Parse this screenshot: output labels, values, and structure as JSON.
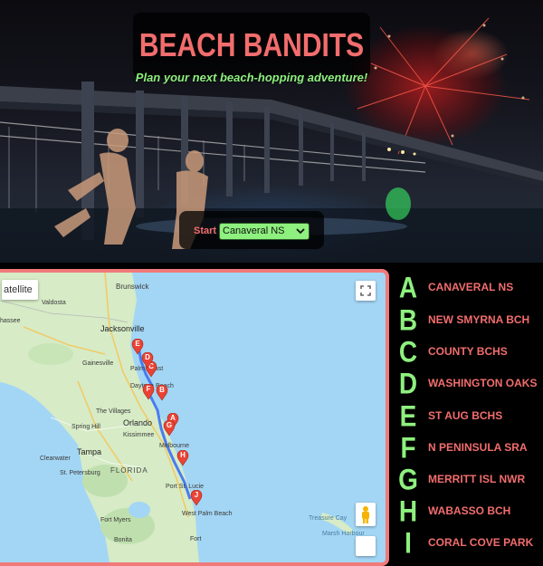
{
  "header": {
    "title": "BEACH BANDITS",
    "subtitle": "Plan your next beach-hopping adventure!",
    "colors": {
      "title": "#f26d6d",
      "subtitle": "#8ef07e"
    }
  },
  "start": {
    "label": "Start",
    "selected": "Canaveral NS"
  },
  "map": {
    "controls": {
      "map_type_label": "atellite",
      "fullscreen_icon": "fullscreen-icon",
      "street_view_icon": "pegman-icon"
    },
    "labels": {
      "brunswick": "Brunswick",
      "valdosta": "Valdosta",
      "tallahassee": "hassee",
      "jacksonville": "Jacksonville",
      "gainesville": "Gainesville",
      "palm_coast": "Palm Coast",
      "daytona": "Daytona Beach",
      "the_villages": "The Villages",
      "orlando": "Orlando",
      "kissimmee": "Kissimmee",
      "spring_hill": "Spring Hill",
      "melbourne": "Melbourne",
      "tampa": "Tampa",
      "clearwater": "Clearwater",
      "st_petersburg": "St. Petersburg",
      "florida": "FLORIDA",
      "port_st_lucie": "Port St. Lucie",
      "west_palm": "West Palm Beach",
      "fort_myers": "Fort Myers",
      "fort": "Fort",
      "treasure_cay": "Treasure Cay",
      "marsh_harbour": "Marsh Harbour",
      "bonita": "Bonita"
    },
    "markers": [
      "A",
      "B",
      "C",
      "D",
      "E",
      "F",
      "G",
      "H",
      "J"
    ]
  },
  "stops": [
    {
      "letter": "A",
      "name": "CANAVERAL NS"
    },
    {
      "letter": "B",
      "name": "NEW SMYRNA BCH"
    },
    {
      "letter": "C",
      "name": "COUNTY BCHS"
    },
    {
      "letter": "D",
      "name": "WASHINGTON OAKS"
    },
    {
      "letter": "E",
      "name": "ST AUG BCHS"
    },
    {
      "letter": "F",
      "name": "N PENINSULA SRA"
    },
    {
      "letter": "G",
      "name": "MERRITT ISL NWR"
    },
    {
      "letter": "H",
      "name": "WABASSO BCH"
    },
    {
      "letter": "I",
      "name": "CORAL COVE PARK"
    }
  ],
  "colors": {
    "accent_red": "#f26d6d",
    "accent_green": "#8ef07e",
    "map_border": "#f07a7a",
    "marker": "#ea4335"
  }
}
